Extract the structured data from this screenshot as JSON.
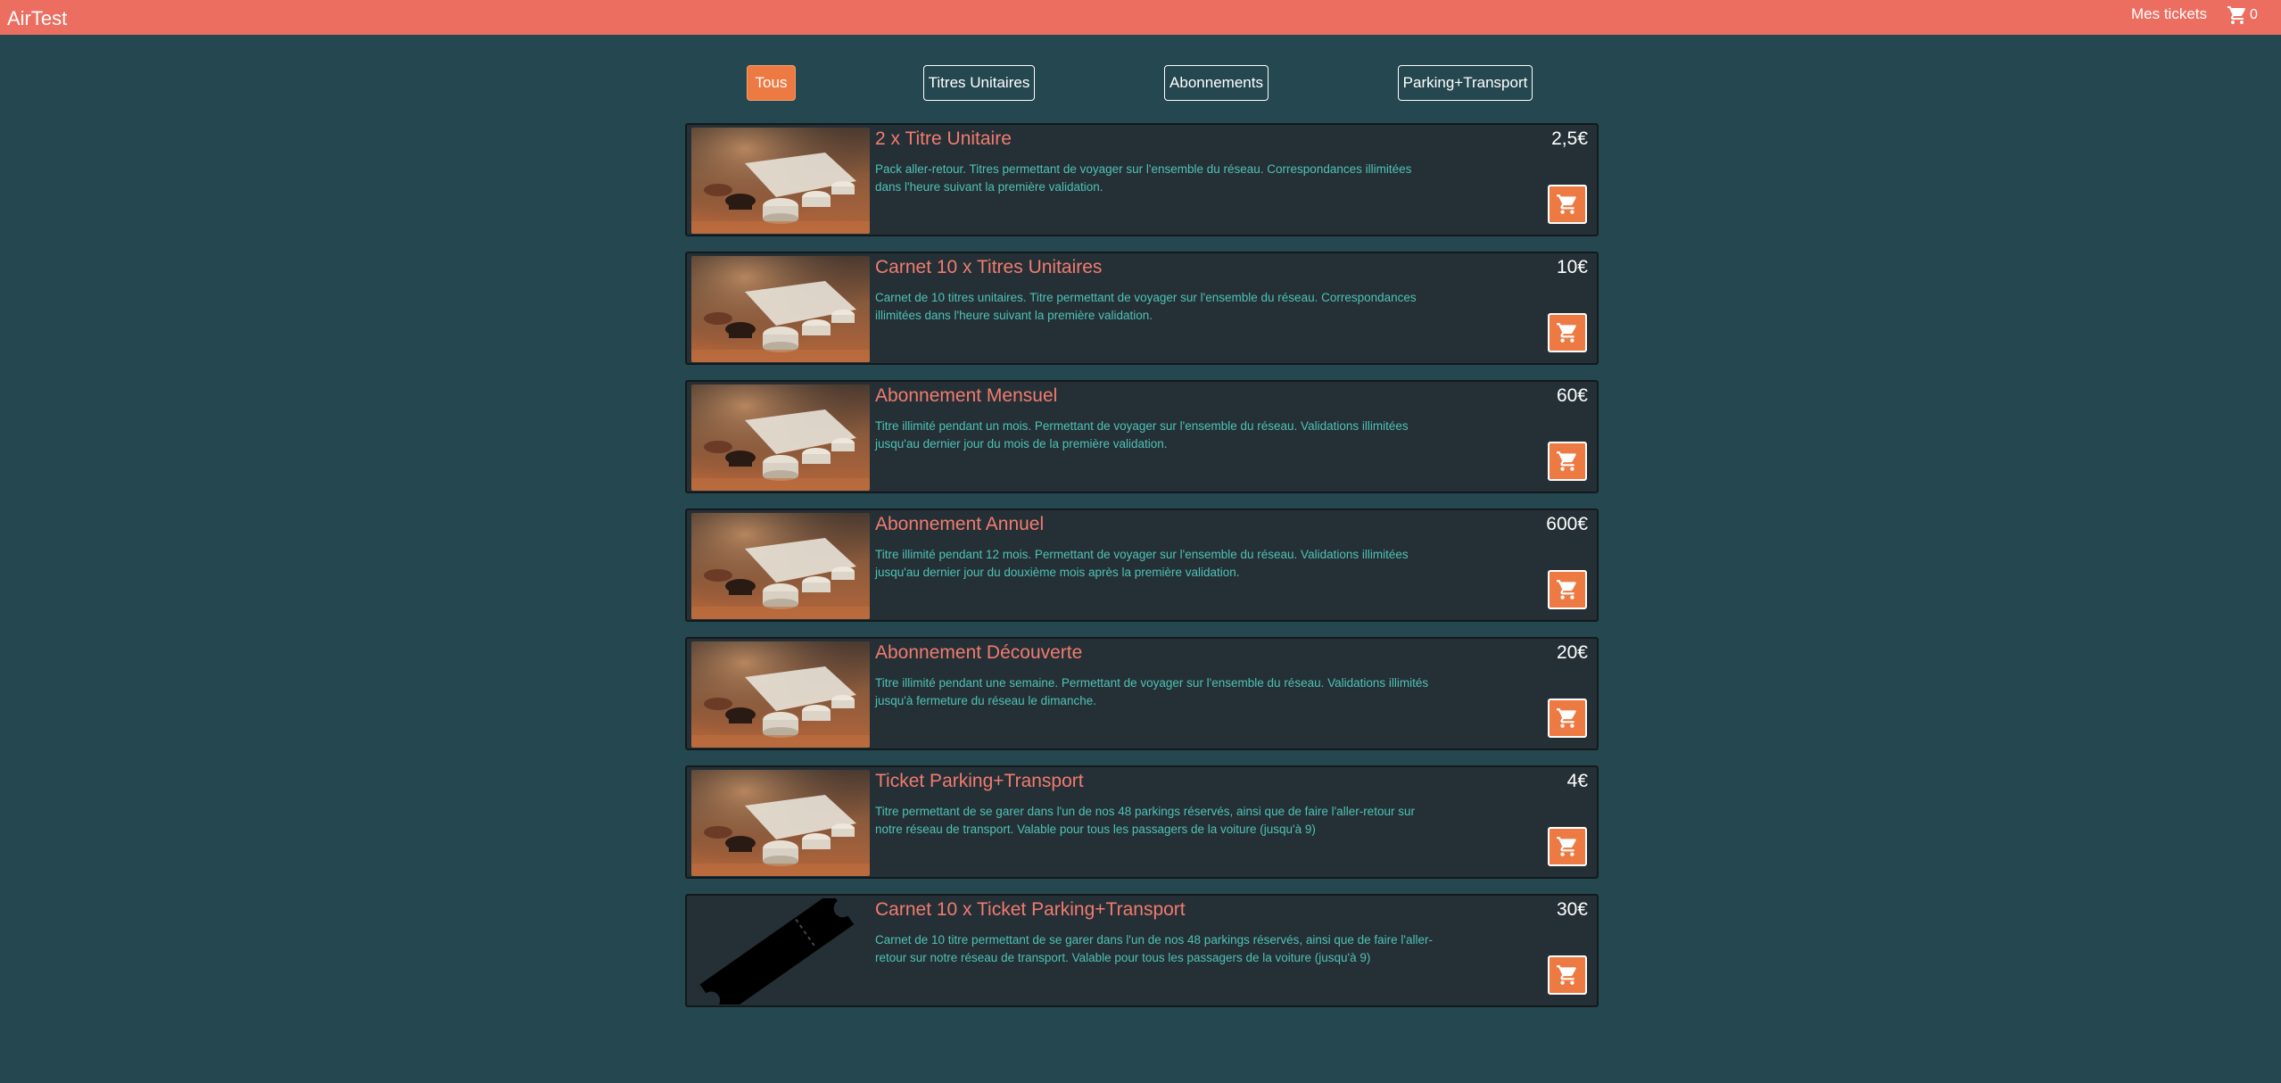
{
  "header": {
    "brand": "AirTest",
    "mes_tickets": "Mes tickets",
    "cart_count": "0"
  },
  "tabs": [
    {
      "label": "Tous",
      "active": true
    },
    {
      "label": "Titres Unitaires",
      "active": false
    },
    {
      "label": "Abonnements",
      "active": false
    },
    {
      "label": "Parking+Transport",
      "active": false
    }
  ],
  "products": [
    {
      "title": "2 x Titre Unitaire",
      "price": "2,5€",
      "description": "Pack aller-retour. Titres permettant de voyager sur l'ensemble du réseau. Correspondances illimitées dans l'heure suivant la première validation.",
      "image": "cups-photo"
    },
    {
      "title": "Carnet 10 x Titres Unitaires",
      "price": "10€",
      "description": "Carnet de 10 titres unitaires. Titre permettant de voyager sur l'ensemble du réseau. Correspondances illimitées dans l'heure suivant la première validation.",
      "image": "cups-photo"
    },
    {
      "title": "Abonnement Mensuel",
      "price": "60€",
      "description": "Titre illimité pendant un mois. Permettant de voyager sur l'ensemble du réseau. Validations illimitées jusqu'au dernier jour du mois de la première validation.",
      "image": "cups-photo"
    },
    {
      "title": "Abonnement Annuel",
      "price": "600€",
      "description": "Titre illimité pendant 12 mois. Permettant de voyager sur l'ensemble du réseau. Validations illimitées jusqu'au dernier jour du douxième mois après la première validation.",
      "image": "cups-photo"
    },
    {
      "title": "Abonnement Découverte",
      "price": "20€",
      "description": "Titre illimité pendant une semaine. Permettant de voyager sur l'ensemble du réseau. Validations illimités jusqu'à fermeture du réseau le dimanche.",
      "image": "cups-photo"
    },
    {
      "title": "Ticket Parking+Transport",
      "price": "4€",
      "description": "Titre permettant de se garer dans l'un de nos 48 parkings réservés, ainsi que de faire l'aller-retour sur notre réseau de transport. Valable pour tous les passagers de la voiture (jusqu'à 9)",
      "image": "cups-photo"
    },
    {
      "title": "Carnet 10 x Ticket Parking+Transport",
      "price": "30€",
      "description": "Carnet de 10 titre permettant de se garer dans l'un de nos 48 parkings réservés, ainsi que de faire l'aller-retour sur notre réseau de transport. Valable pour tous les passagers de la voiture (jusqu'à 9)",
      "image": "ticket-icon"
    }
  ],
  "colors": {
    "background": "#254750",
    "header": "#ec6e60",
    "accent": "#ee7a43",
    "title": "#f27b6f",
    "description": "#50c1b5",
    "card": "#243036"
  }
}
